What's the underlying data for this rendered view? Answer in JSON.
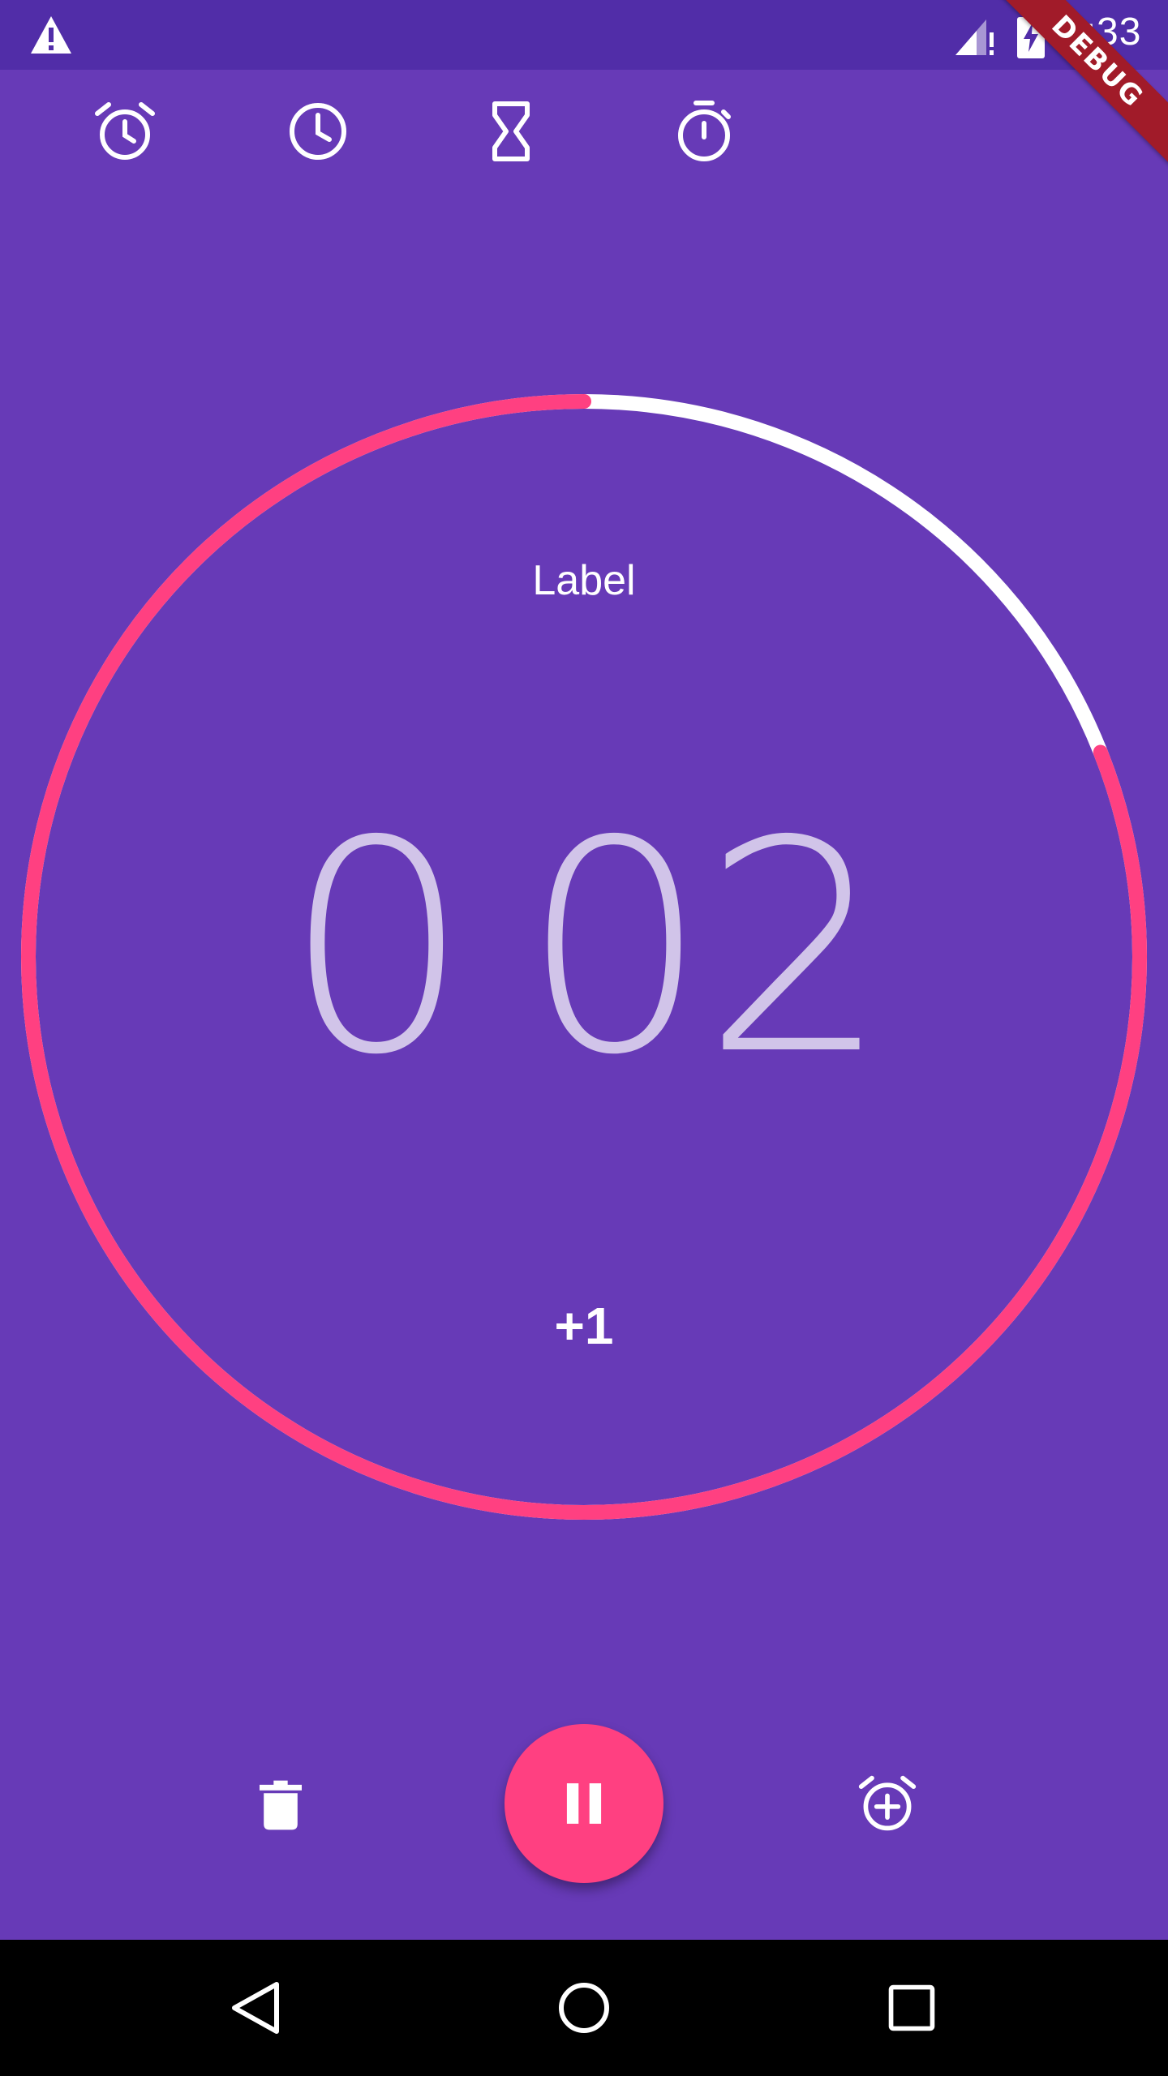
{
  "status_bar": {
    "time": "2:33",
    "icons": [
      "warning-icon",
      "signal-icon",
      "battery-charging-icon"
    ]
  },
  "debug_banner": "DEBUG",
  "tabs": [
    {
      "name": "alarm",
      "icon": "alarm-icon"
    },
    {
      "name": "clock",
      "icon": "clock-icon"
    },
    {
      "name": "timer",
      "icon": "hourglass-icon"
    },
    {
      "name": "stopwatch",
      "icon": "stopwatch-icon"
    }
  ],
  "timer": {
    "label": "Label",
    "minutes": "0",
    "seconds": "02",
    "add_minute_label": "+1",
    "progress_remaining_fraction": 0.81
  },
  "colors": {
    "background": "#673ab7",
    "status_bar": "#512da8",
    "accent": "#ff4081",
    "ring_track": "#ffffff",
    "digits": "#d1c4e9",
    "nav_bar": "#000000",
    "debug_ribbon": "#a11b29"
  },
  "bottom_controls": {
    "delete_icon": "delete-icon",
    "pause_icon": "pause-icon",
    "add_timer_icon": "add-alarm-icon"
  },
  "nav_bar": {
    "icons": [
      "back-icon",
      "home-icon",
      "recents-icon"
    ]
  }
}
